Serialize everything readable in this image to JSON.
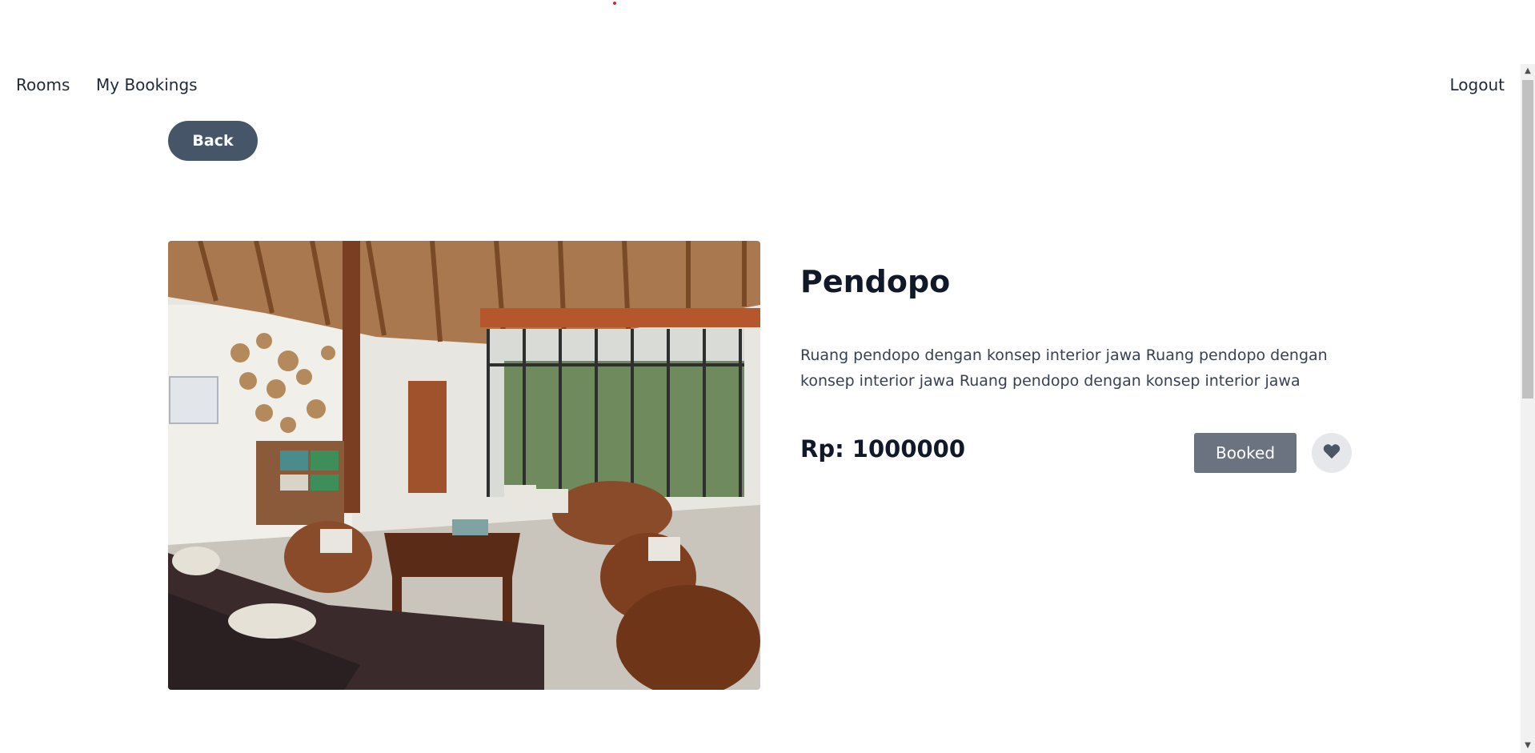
{
  "nav": {
    "rooms": "Rooms",
    "my_bookings": "My Bookings",
    "logout": "Logout"
  },
  "back_label": "Back",
  "room": {
    "name": "Pendopo",
    "description": "Ruang pendopo dengan konsep interior jawa Ruang pendopo dengan konsep interior jawa Ruang pendopo dengan konsep interior jawa",
    "price": "Rp: 1000000",
    "status_label": "Booked"
  },
  "icons": {
    "favorite": "heart-icon",
    "scroll_up": "arrow-up-icon",
    "scroll_down": "arrow-down-icon"
  },
  "colors": {
    "back_button": "#475569",
    "booked_button": "#6b7280",
    "favorite_bg": "#e5e7eb"
  }
}
